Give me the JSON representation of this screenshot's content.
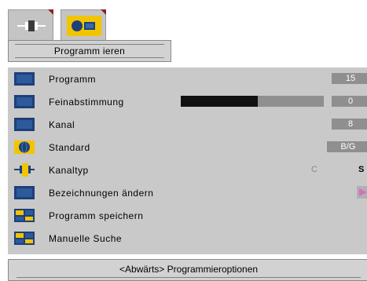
{
  "tabs": [
    {
      "icon": "scart-connector-icon",
      "selected": false
    },
    {
      "icon": "tv-settings-icon",
      "selected": true
    }
  ],
  "header": {
    "title": "Programm ieren"
  },
  "menu": {
    "items": [
      {
        "label": "Programm",
        "icon": "tv-screen-icon",
        "value": "15"
      },
      {
        "label": "Feinabstimmung",
        "icon": "tv-screen-icon",
        "value": "0",
        "level": 0.54
      },
      {
        "label": "Kanal",
        "icon": "tv-screen-icon",
        "value": "8"
      },
      {
        "label": "Standard",
        "icon": "globe-icon",
        "value": "B/G"
      },
      {
        "label": "Kanaltyp",
        "icon": "scart-connector-icon",
        "option_c": "C",
        "option_s": "S"
      },
      {
        "label": "Bezeichnungen ändern",
        "icon": "tv-screen-icon"
      },
      {
        "label": "Programm speichern",
        "icon": "tv-grid-icon"
      },
      {
        "label": "Manuelle Suche",
        "icon": "tv-grid-icon"
      }
    ]
  },
  "footer": {
    "text": "<Abwärts> Programmieroptionen"
  },
  "colors": {
    "accent": "#f2c400",
    "screen": "#1d3f7a",
    "panel": "#c9c9c9",
    "value_box": "#8f8f8f"
  }
}
